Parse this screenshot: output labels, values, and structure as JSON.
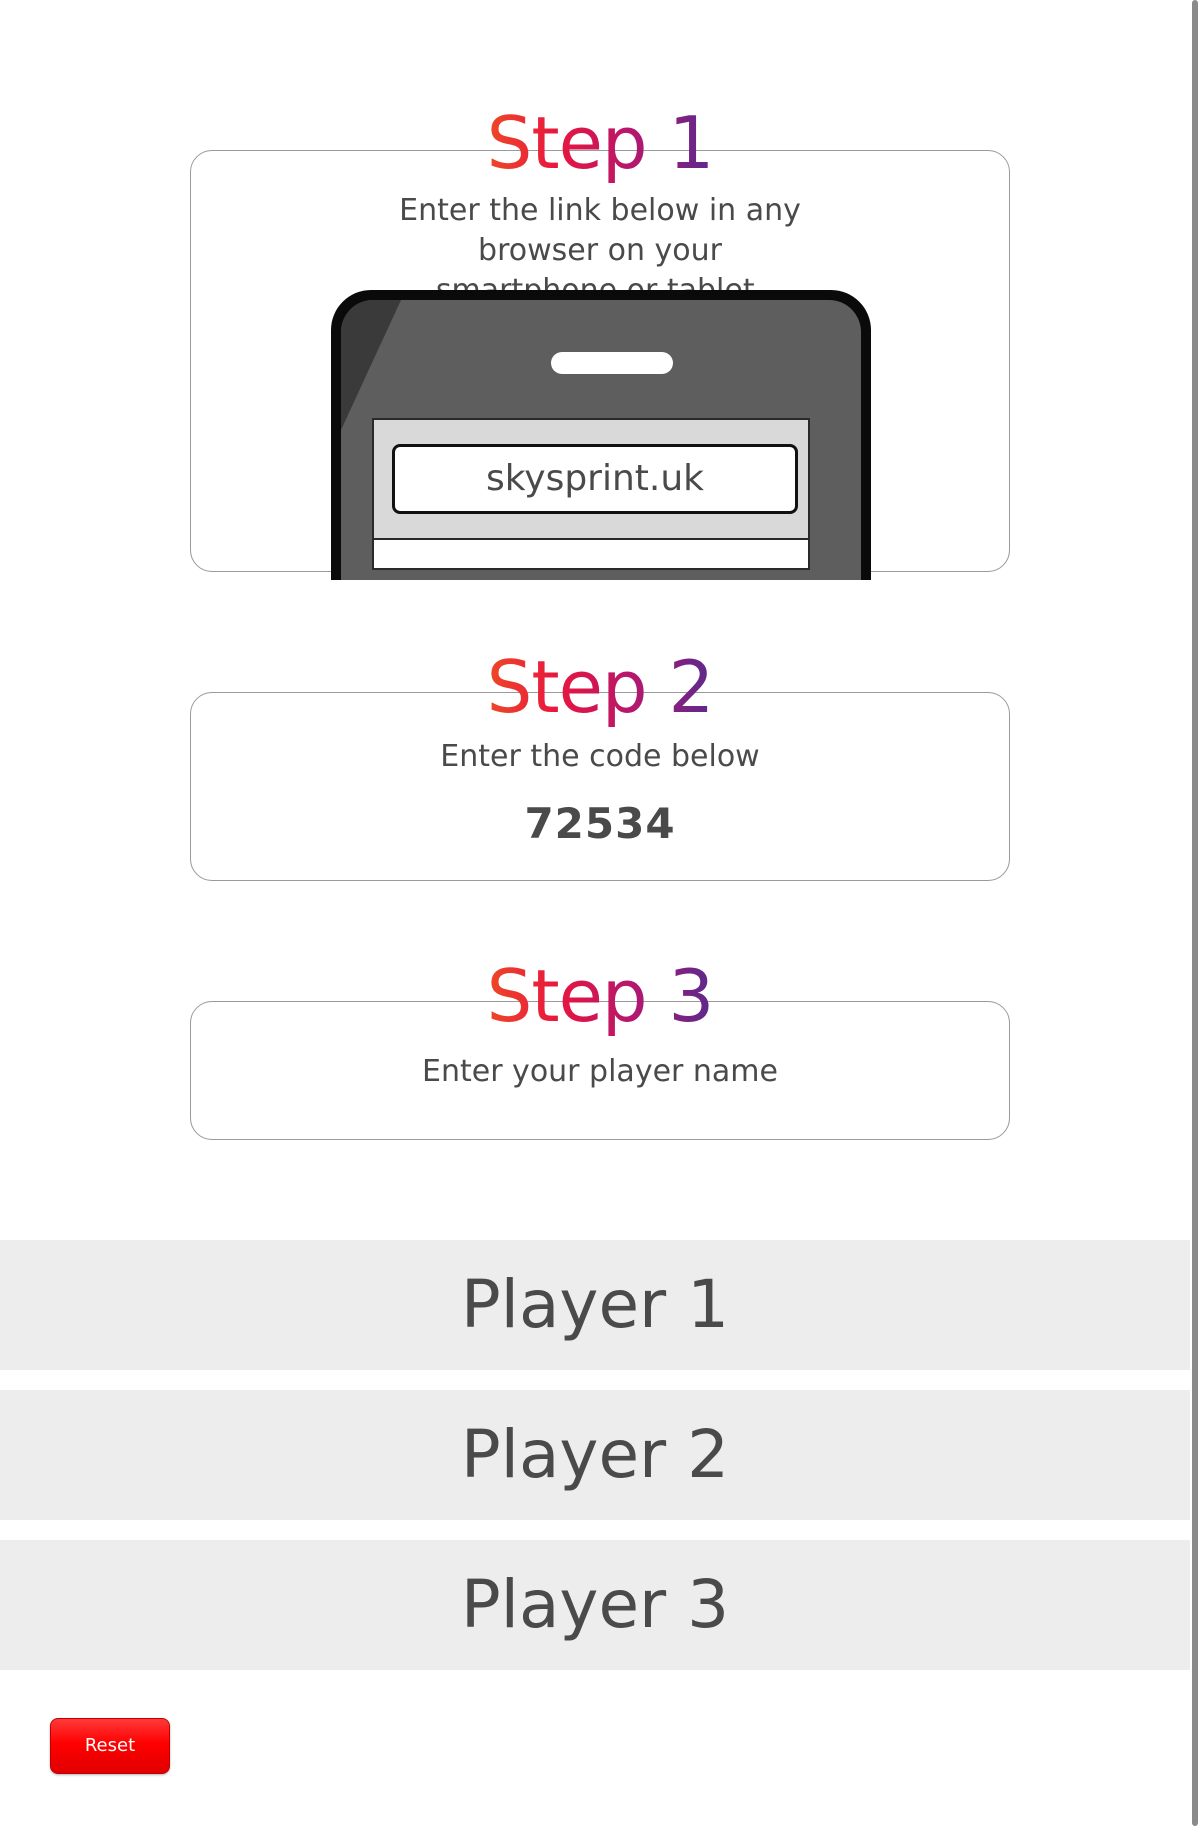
{
  "steps": [
    {
      "title": "Step 1",
      "text": "Enter the link below in any browser on your smartphone or tablet."
    },
    {
      "title": "Step 2",
      "text": "Enter the code below",
      "code": "72534"
    },
    {
      "title": "Step 3",
      "text": "Enter your player name"
    }
  ],
  "phone": {
    "url": "skysprint.uk"
  },
  "players": [
    "Player 1",
    "Player 2",
    "Player 3"
  ],
  "reset_label": "Reset",
  "colors": {
    "gradient_start": "#f05a1e",
    "gradient_mid": "#e8163e",
    "gradient_end": "#3c2f98",
    "player_row_bg": "#ededed",
    "reset_button": "#ff0000"
  }
}
